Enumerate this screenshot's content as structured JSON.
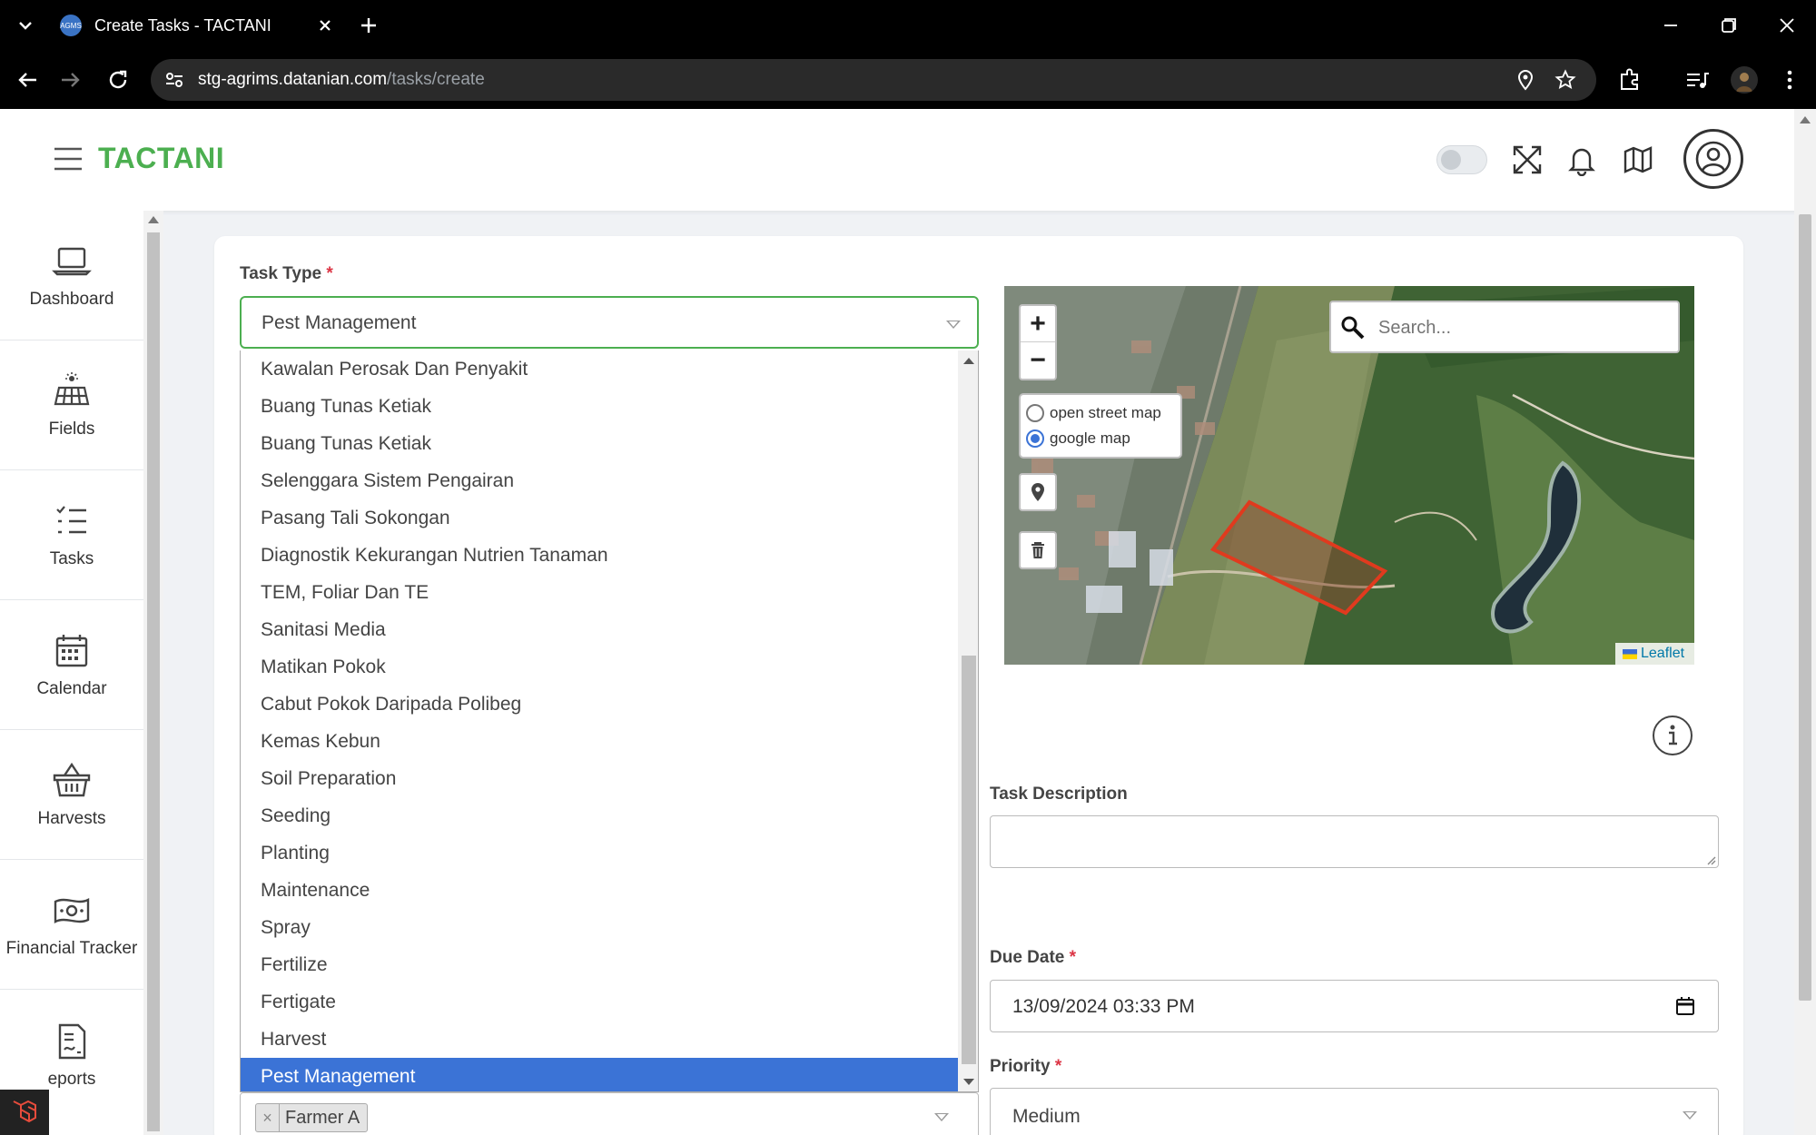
{
  "browser": {
    "tab_title": "Create Tasks - TACTANI",
    "favicon_text": "AGMS",
    "url_host": "stg-agrims.datanian.com",
    "url_path": "/tasks/create"
  },
  "app": {
    "brand": "TACTANI",
    "brand_color": "#4caf50"
  },
  "sidebar": {
    "items": [
      {
        "label": "Dashboard",
        "icon": "laptop-icon"
      },
      {
        "label": "Fields",
        "icon": "solar-panel-icon"
      },
      {
        "label": "Tasks",
        "icon": "task-list-icon"
      },
      {
        "label": "Calendar",
        "icon": "calendar-icon"
      },
      {
        "label": "Harvests",
        "icon": "basket-icon"
      },
      {
        "label": "Financial Tracker",
        "icon": "money-icon"
      },
      {
        "label": "eports",
        "icon": "report-icon"
      }
    ]
  },
  "form": {
    "task_type_label": "Task Type",
    "required_mark": "*",
    "task_type_value": "Pest Management",
    "task_type_options": [
      "Kawalan Perosak Dan Penyakit",
      "Buang Tunas Ketiak",
      "Buang Tunas Ketiak",
      "Selenggara Sistem Pengairan",
      "Pasang Tali Sokongan",
      "Diagnostik Kekurangan Nutrien Tanaman",
      "TEM, Foliar Dan TE",
      "Sanitasi Media",
      "Matikan Pokok",
      "Cabut Pokok Daripada Polibeg",
      "Kemas Kebun",
      "Soil Preparation",
      "Seeding",
      "Planting",
      "Maintenance",
      "Spray",
      "Fertilize",
      "Fertigate",
      "Harvest",
      "Pest Management"
    ],
    "task_description_label": "Task Description",
    "due_date_label": "Due Date",
    "due_date_value": "13/09/2024 03:33 PM",
    "priority_label": "Priority",
    "priority_value": "Medium",
    "assignee_chip": "Farmer A",
    "chip_remove": "×"
  },
  "map": {
    "zoom_in": "+",
    "zoom_out": "−",
    "search_placeholder": "Search...",
    "layers": [
      {
        "label": "open street map",
        "selected": false
      },
      {
        "label": "google map",
        "selected": true
      }
    ],
    "attribution": "Leaflet",
    "polygon_color": "#e03a1e"
  }
}
